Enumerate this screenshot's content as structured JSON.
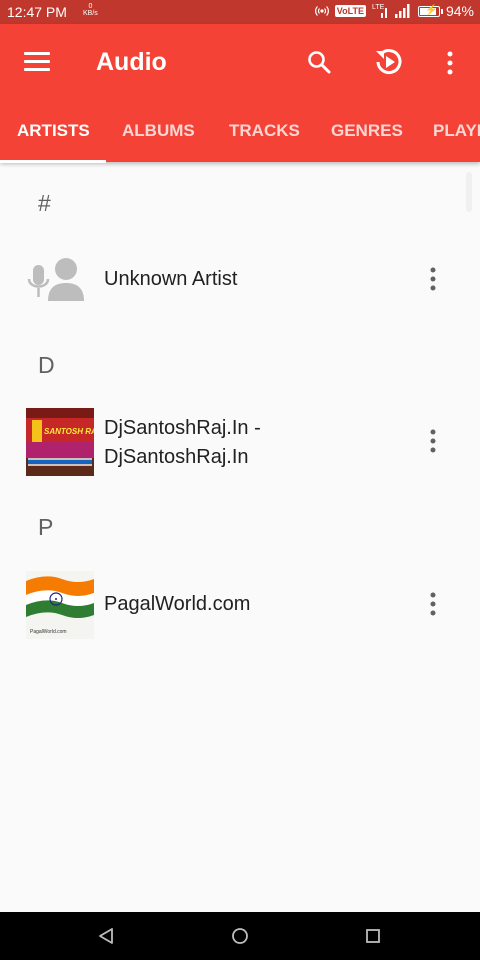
{
  "status_bar": {
    "time": "12:47 PM",
    "speed_value": "0",
    "speed_unit": "KB/s",
    "volte": "VoLTE",
    "lte": "LTE",
    "battery": "94%",
    "battery_level": 0.94
  },
  "appbar": {
    "title": "Audio",
    "icons": [
      "menu-icon",
      "search-icon",
      "history-icon",
      "more-vert-icon"
    ],
    "color": "#f44336",
    "status_color": "#c0372d"
  },
  "tabs": [
    {
      "label": "ARTISTS",
      "active": true
    },
    {
      "label": "ALBUMS",
      "active": false
    },
    {
      "label": "TRACKS",
      "active": false
    },
    {
      "label": "GENRES",
      "active": false
    },
    {
      "label": "PLAYLISTS",
      "active": false
    }
  ],
  "sections": [
    {
      "letter": "#",
      "artists": [
        {
          "name": "Unknown Artist",
          "thumb": "unknown-artist-icon"
        }
      ]
    },
    {
      "letter": "D",
      "artists": [
        {
          "name_line1": "DjSantoshRaj.In -",
          "name_line2": "DjSantoshRaj.In",
          "thumb": "album-art",
          "thumb_text": "SANTOSH RAJ"
        }
      ]
    },
    {
      "letter": "P",
      "artists": [
        {
          "name": "PagalWorld.com",
          "thumb": "indian-flag-art",
          "thumb_text": "PagalWorld.com"
        }
      ]
    }
  ],
  "nav": [
    "back-icon",
    "home-icon",
    "recents-icon"
  ]
}
